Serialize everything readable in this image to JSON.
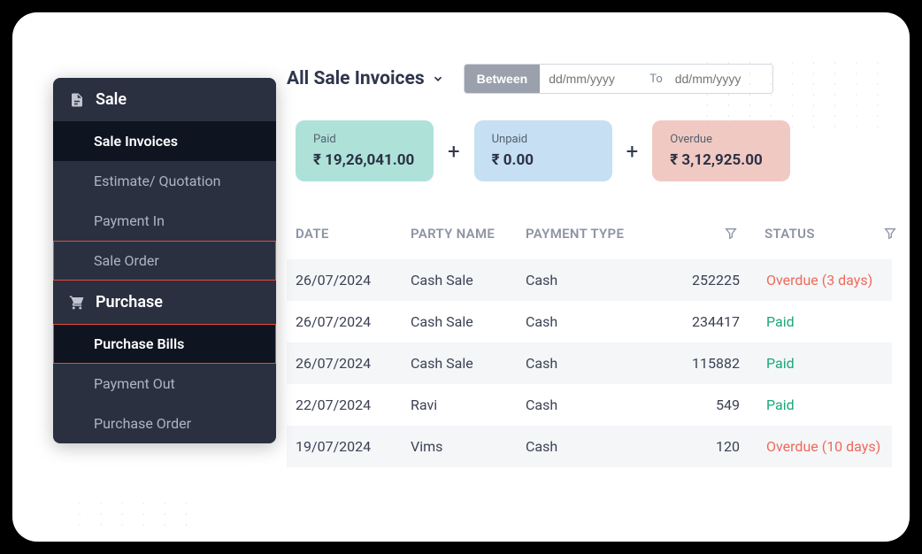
{
  "sidebar": {
    "sale_header": "Sale",
    "purchase_header": "Purchase",
    "sale_items": [
      {
        "label": "Sale Invoices"
      },
      {
        "label": "Estimate/ Quotation"
      },
      {
        "label": "Payment In"
      },
      {
        "label": "Sale Order"
      }
    ],
    "purchase_items": [
      {
        "label": "Purchase Bills"
      },
      {
        "label": "Payment Out"
      },
      {
        "label": "Purchase Order"
      }
    ]
  },
  "header": {
    "title": "All Sale Invoices",
    "between_label": "Between",
    "date_placeholder_from": "dd/mm/yyyy",
    "to_label": "To",
    "date_placeholder_to": "dd/mm/yyyy"
  },
  "summary": {
    "paid_label": "Paid",
    "paid_value": "₹ 19,26,041.00",
    "unpaid_label": "Unpaid",
    "unpaid_value": "₹ 0.00",
    "overdue_label": "Overdue",
    "overdue_value": "₹ 3,12,925.00"
  },
  "table": {
    "columns": {
      "date": "DATE",
      "party": "PARTY NAME",
      "payment_type": "PAYMENT TYPE",
      "status": "STATUS"
    },
    "rows": [
      {
        "date": "26/07/2024",
        "party": "Cash Sale",
        "payment_type": "Cash",
        "amount": "252225",
        "status": "Overdue (3 days)",
        "status_class": "overdue"
      },
      {
        "date": "26/07/2024",
        "party": "Cash Sale",
        "payment_type": "Cash",
        "amount": "234417",
        "status": "Paid",
        "status_class": "paid"
      },
      {
        "date": "26/07/2024",
        "party": "Cash Sale",
        "payment_type": "Cash",
        "amount": "115882",
        "status": "Paid",
        "status_class": "paid"
      },
      {
        "date": "22/07/2024",
        "party": "Ravi",
        "payment_type": "Cash",
        "amount": "549",
        "status": "Paid",
        "status_class": "paid"
      },
      {
        "date": "19/07/2024",
        "party": "Vims",
        "payment_type": "Cash",
        "amount": "120",
        "status": "Overdue (10 days)",
        "status_class": "overdue"
      }
    ]
  }
}
